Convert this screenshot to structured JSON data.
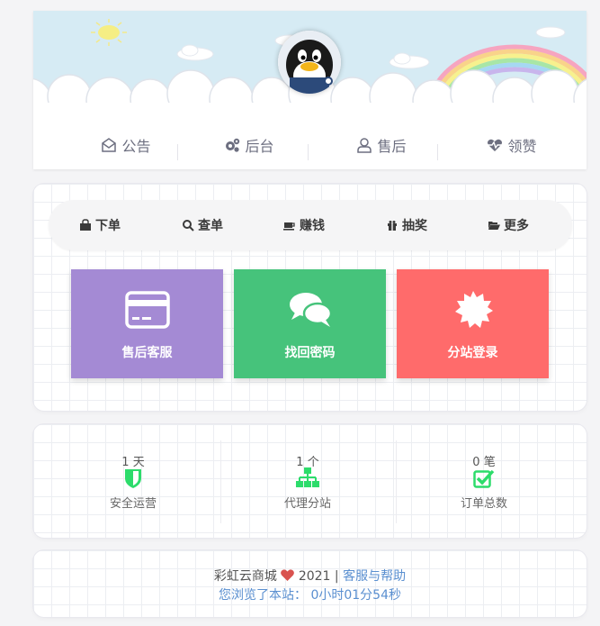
{
  "header": {
    "nav": [
      {
        "label": "公告",
        "icon": "envelope-open-icon"
      },
      {
        "label": "后台",
        "icon": "cogs-icon"
      },
      {
        "label": "售后",
        "icon": "user-icon"
      },
      {
        "label": "领赞",
        "icon": "heartbeat-icon"
      }
    ]
  },
  "menu": {
    "tabs": [
      {
        "label": "下单",
        "icon": "shopping-bag-icon"
      },
      {
        "label": "查单",
        "icon": "search-icon"
      },
      {
        "label": "赚钱",
        "icon": "coffee-icon"
      },
      {
        "label": "抽奖",
        "icon": "gift-icon"
      },
      {
        "label": "更多",
        "icon": "folder-open-icon"
      }
    ],
    "tiles": [
      {
        "label": "售后客服",
        "icon": "credit-card-icon",
        "color": "#a48ad4"
      },
      {
        "label": "找回密码",
        "icon": "comments-icon",
        "color": "#46c37b"
      },
      {
        "label": "分站登录",
        "icon": "certificate-icon",
        "color": "#ff6b6b"
      }
    ]
  },
  "stats": [
    {
      "value": "1 天",
      "label": "安全运营",
      "icon": "shield-icon"
    },
    {
      "value": "1 个",
      "label": "代理分站",
      "icon": "sitemap-icon"
    },
    {
      "value": "0 笔",
      "label": "订单总数",
      "icon": "check-square-icon"
    }
  ],
  "colors": {
    "accent_green": "#2ddc6b",
    "link": "#5a8fd0",
    "heart": "#d9534f"
  },
  "footer": {
    "brand": "彩虹云商城",
    "year": "2021",
    "divider": "|",
    "help_link": "客服与帮助",
    "browse_prefix": "您浏览了本站：",
    "browse_time": "0小时01分54秒"
  }
}
